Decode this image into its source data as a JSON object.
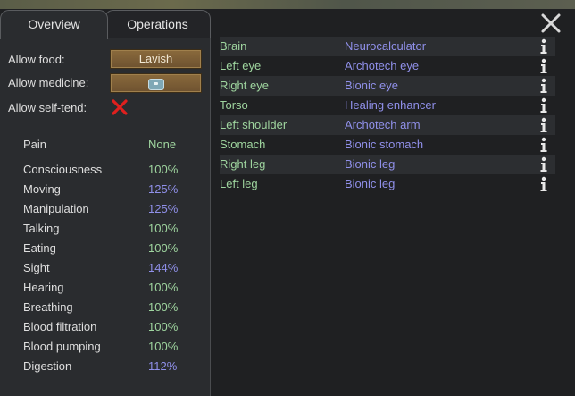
{
  "tabs": [
    {
      "label": "Overview"
    },
    {
      "label": "Operations"
    }
  ],
  "settings": {
    "allow_food_label": "Allow food:",
    "allow_food_value": "Lavish",
    "allow_medicine_label": "Allow medicine:",
    "allow_medicine_icon": "medicine-icon",
    "allow_self_tend_label": "Allow self-tend:",
    "allow_self_tend_state": "off-red-x"
  },
  "pain": {
    "label": "Pain",
    "value": "None"
  },
  "capacities": [
    {
      "name": "Consciousness",
      "value": "100%"
    },
    {
      "name": "Moving",
      "value": "125%"
    },
    {
      "name": "Manipulation",
      "value": "125%"
    },
    {
      "name": "Talking",
      "value": "100%"
    },
    {
      "name": "Eating",
      "value": "100%"
    },
    {
      "name": "Sight",
      "value": "144%"
    },
    {
      "name": "Hearing",
      "value": "100%"
    },
    {
      "name": "Breathing",
      "value": "100%"
    },
    {
      "name": "Blood filtration",
      "value": "100%"
    },
    {
      "name": "Blood pumping",
      "value": "100%"
    },
    {
      "name": "Digestion",
      "value": "112%"
    }
  ],
  "health_parts": [
    {
      "part": "Brain",
      "hediff": "Neurocalculator"
    },
    {
      "part": "Left eye",
      "hediff": "Archotech eye"
    },
    {
      "part": "Right eye",
      "hediff": "Bionic eye"
    },
    {
      "part": "Torso",
      "hediff": "Healing enhancer"
    },
    {
      "part": "Left shoulder",
      "hediff": "Archotech arm"
    },
    {
      "part": "Stomach",
      "hediff": "Bionic stomach"
    },
    {
      "part": "Right leg",
      "hediff": "Bionic leg"
    },
    {
      "part": "Left leg",
      "hediff": "Bionic leg"
    }
  ],
  "colors": {
    "normal_value": "#9fd59f",
    "enhanced_value": "#9090ea",
    "part_name": "#9fd59f",
    "hediff": "#9090ea"
  },
  "icons": {
    "close": "close-icon",
    "info": "info-icon",
    "self_tend": "red-x-icon"
  }
}
